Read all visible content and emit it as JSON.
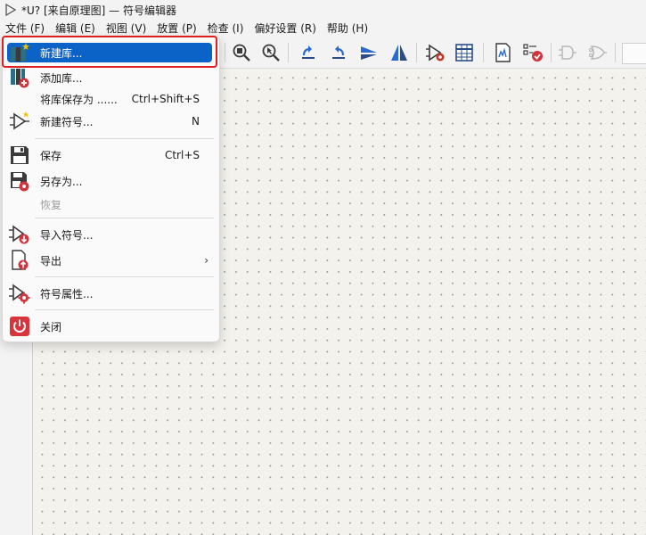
{
  "window": {
    "title": "*U? [来自原理图] — 符号编辑器"
  },
  "menubar": {
    "items": [
      "文件 (F)",
      "编辑 (E)",
      "视图 (V)",
      "放置 (P)",
      "检查 (I)",
      "偏好设置 (R)",
      "帮助 (H)"
    ]
  },
  "toolbar": {
    "icons": [
      "zoom-fit-icon",
      "zoom-selection-icon",
      "rotate-ccw-icon",
      "rotate-cw-icon",
      "mirror-horizontal-icon",
      "mirror-vertical-icon",
      "symbol-properties-icon",
      "pin-table-icon",
      "datasheet-icon",
      "check-icon",
      "de-morgan-standard-icon",
      "de-morgan-alternate-icon"
    ]
  },
  "file_menu": {
    "items": [
      {
        "label": "新建库...",
        "shortcut": "",
        "icon": "new-library-icon"
      },
      {
        "label": "添加库...",
        "shortcut": "",
        "icon": "add-library-icon"
      },
      {
        "label": "将库保存为 ......",
        "shortcut": "Ctrl+Shift+S",
        "icon": ""
      },
      {
        "label": "新建符号...",
        "shortcut": "N",
        "icon": "new-symbol-icon"
      },
      {
        "label": "保存",
        "shortcut": "Ctrl+S",
        "icon": "save-icon"
      },
      {
        "label": "另存为...",
        "shortcut": "",
        "icon": "save-as-icon"
      },
      {
        "label": "恢复",
        "shortcut": "",
        "icon": ""
      },
      {
        "label": "导入符号...",
        "shortcut": "",
        "icon": "import-symbol-icon"
      },
      {
        "label": "导出",
        "shortcut": "",
        "icon": "export-icon",
        "submenu": "›"
      },
      {
        "label": "符号属性...",
        "shortcut": "",
        "icon": "symbol-properties-icon"
      },
      {
        "label": "关闭",
        "shortcut": "",
        "icon": "power-icon"
      }
    ]
  },
  "colors": {
    "highlight": "#0b63c7",
    "annotation_box": "#e02020",
    "canvas": "#f4f2ec",
    "close_icon": "#d8343c"
  }
}
